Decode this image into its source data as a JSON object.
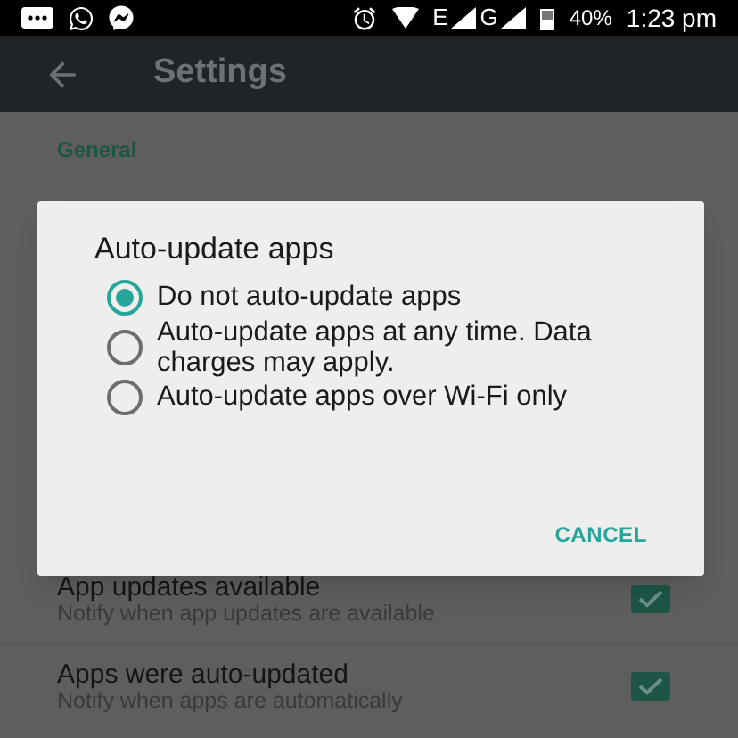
{
  "status_bar": {
    "network_1": "E",
    "network_2": "G",
    "battery": "40%",
    "time": "1:23 pm"
  },
  "toolbar": {
    "title": "Settings"
  },
  "section": {
    "title": "General"
  },
  "settings": [
    {
      "title": "App updates available",
      "subtitle": "Notify when app updates are available",
      "checked": true
    },
    {
      "title": "Apps were auto-updated",
      "subtitle": "Notify when apps are automatically",
      "checked": true
    }
  ],
  "dialog": {
    "title": "Auto-update apps",
    "options": [
      {
        "label": "Do not auto-update apps",
        "selected": true
      },
      {
        "label": "Auto-update apps at any time. Data charges may apply.",
        "selected": false
      },
      {
        "label": "Auto-update apps over Wi-Fi only",
        "selected": false
      }
    ],
    "button": "CANCEL"
  }
}
